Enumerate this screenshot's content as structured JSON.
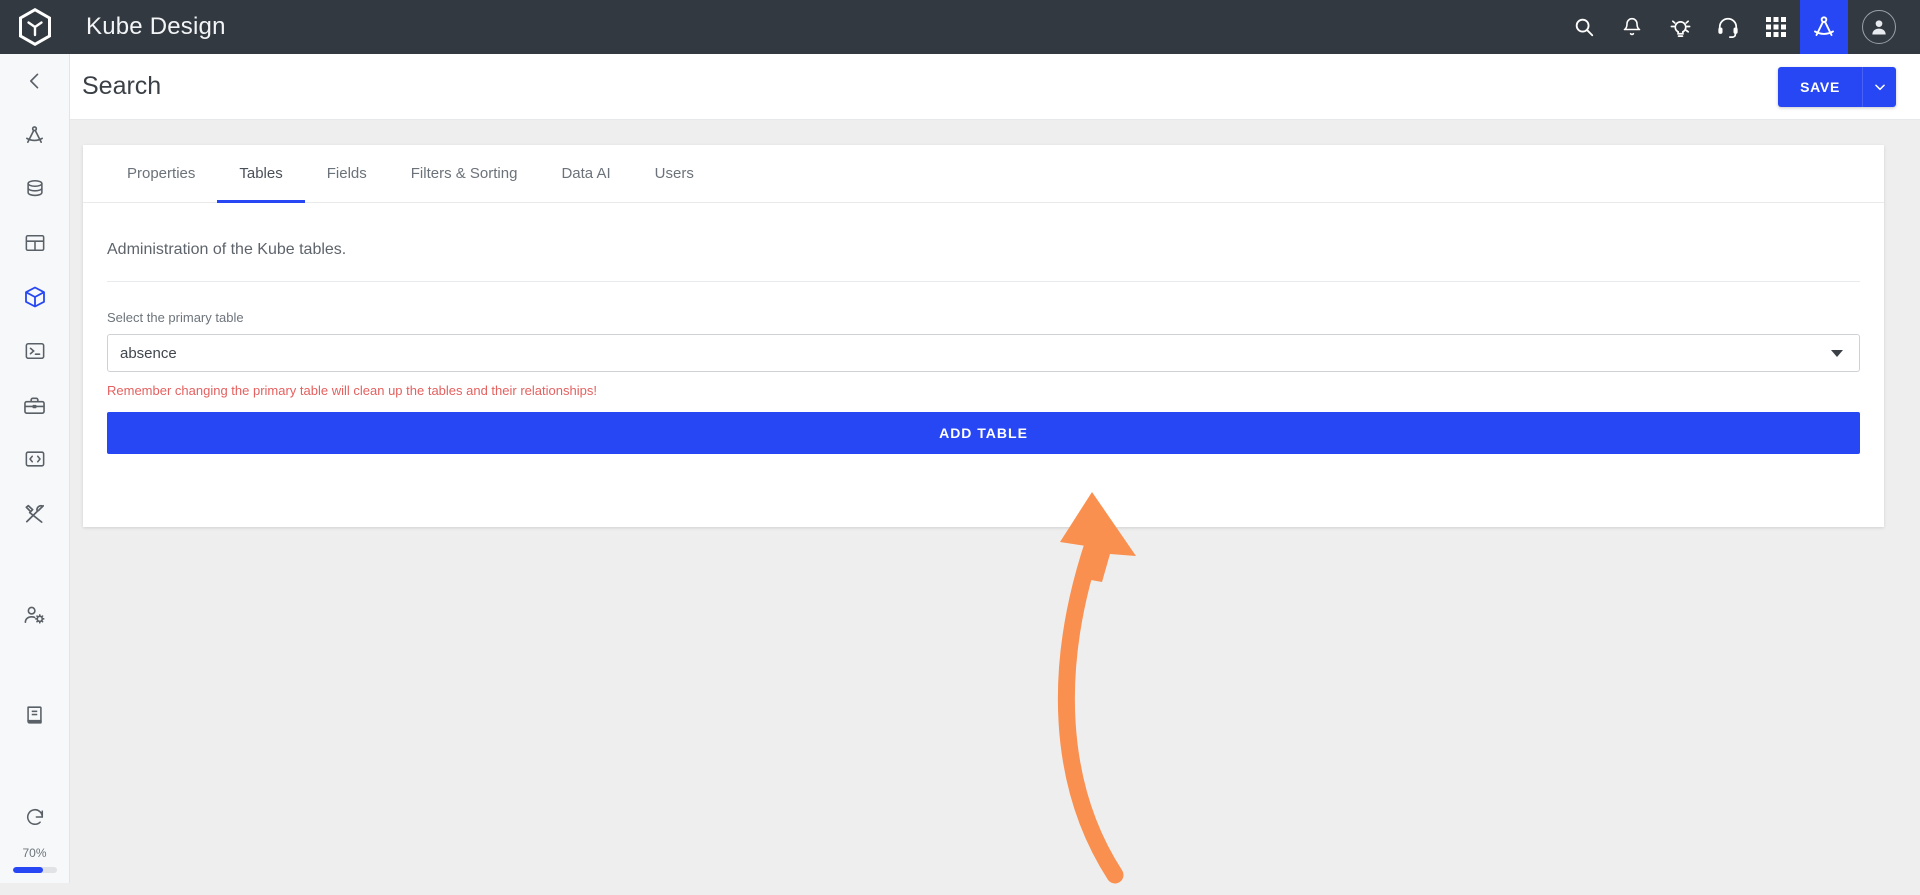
{
  "topbar": {
    "logo_icon": "kube-hexagon-logo",
    "brand": "Kube Design",
    "icons": [
      {
        "name": "search-icon",
        "label": "Search"
      },
      {
        "name": "bell-icon",
        "label": "Notifications"
      },
      {
        "name": "lightbulb-idea-icon",
        "label": "Ideas"
      },
      {
        "name": "headset-support-icon",
        "label": "Support"
      },
      {
        "name": "apps-grid-icon",
        "label": "Apps"
      },
      {
        "name": "drafting-compass-icon",
        "label": "Design"
      }
    ],
    "avatar_icon": "user-avatar-icon",
    "active_icon": "drafting-compass-icon",
    "accent": "#2747f4",
    "background": "#333940"
  },
  "sidebar": {
    "collapse_icon": "chevron-left-icon",
    "items": [
      {
        "name": "sidebar-item-design",
        "icon": "drafting-compass-icon",
        "active": false
      },
      {
        "name": "sidebar-item-database",
        "icon": "database-icon",
        "active": false
      },
      {
        "name": "sidebar-item-tables",
        "icon": "table-grid-icon",
        "active": false
      },
      {
        "name": "sidebar-item-models",
        "icon": "cube-icon",
        "active": true
      },
      {
        "name": "sidebar-item-terminal",
        "icon": "terminal-icon",
        "active": false
      },
      {
        "name": "sidebar-item-toolbox",
        "icon": "toolbox-icon",
        "active": false
      },
      {
        "name": "sidebar-item-code",
        "icon": "code-brackets-icon",
        "active": false
      },
      {
        "name": "sidebar-item-tools",
        "icon": "screwdriver-wrench-icon",
        "active": false
      },
      {
        "name": "sidebar-item-user-settings",
        "icon": "user-gear-icon",
        "active": false
      },
      {
        "name": "sidebar-item-docs",
        "icon": "book-icon",
        "active": false
      }
    ],
    "footer": {
      "refresh_icon": "redo-arrow-icon",
      "percent_label": "70%",
      "percent_value": 70,
      "bar_color": "#2747f4"
    }
  },
  "page_header": {
    "title": "Search",
    "save_label": "SAVE",
    "save_caret_icon": "chevron-down-icon"
  },
  "tabs": [
    {
      "label": "Properties",
      "name": "tab-properties",
      "active": false
    },
    {
      "label": "Tables",
      "name": "tab-tables",
      "active": true
    },
    {
      "label": "Fields",
      "name": "tab-fields",
      "active": false
    },
    {
      "label": "Filters & Sorting",
      "name": "tab-filters-sorting",
      "active": false
    },
    {
      "label": "Data AI",
      "name": "tab-data-ai",
      "active": false
    },
    {
      "label": "Users",
      "name": "tab-users",
      "active": false
    }
  ],
  "main": {
    "description": "Administration of the Kube tables.",
    "field_label": "Select the primary table",
    "select_value": "absence",
    "select_caret_icon": "caret-down-icon",
    "warning": "Remember changing the primary table will clean up the tables and their relationships!",
    "warning_color": "#e4615f",
    "add_table_label": "ADD TABLE",
    "add_table_color": "#2747f4"
  },
  "annotation": {
    "name": "callout-arrow",
    "icon": "curved-arrow-up-icon",
    "color": "#f99050",
    "points_to": "add-table-button"
  }
}
